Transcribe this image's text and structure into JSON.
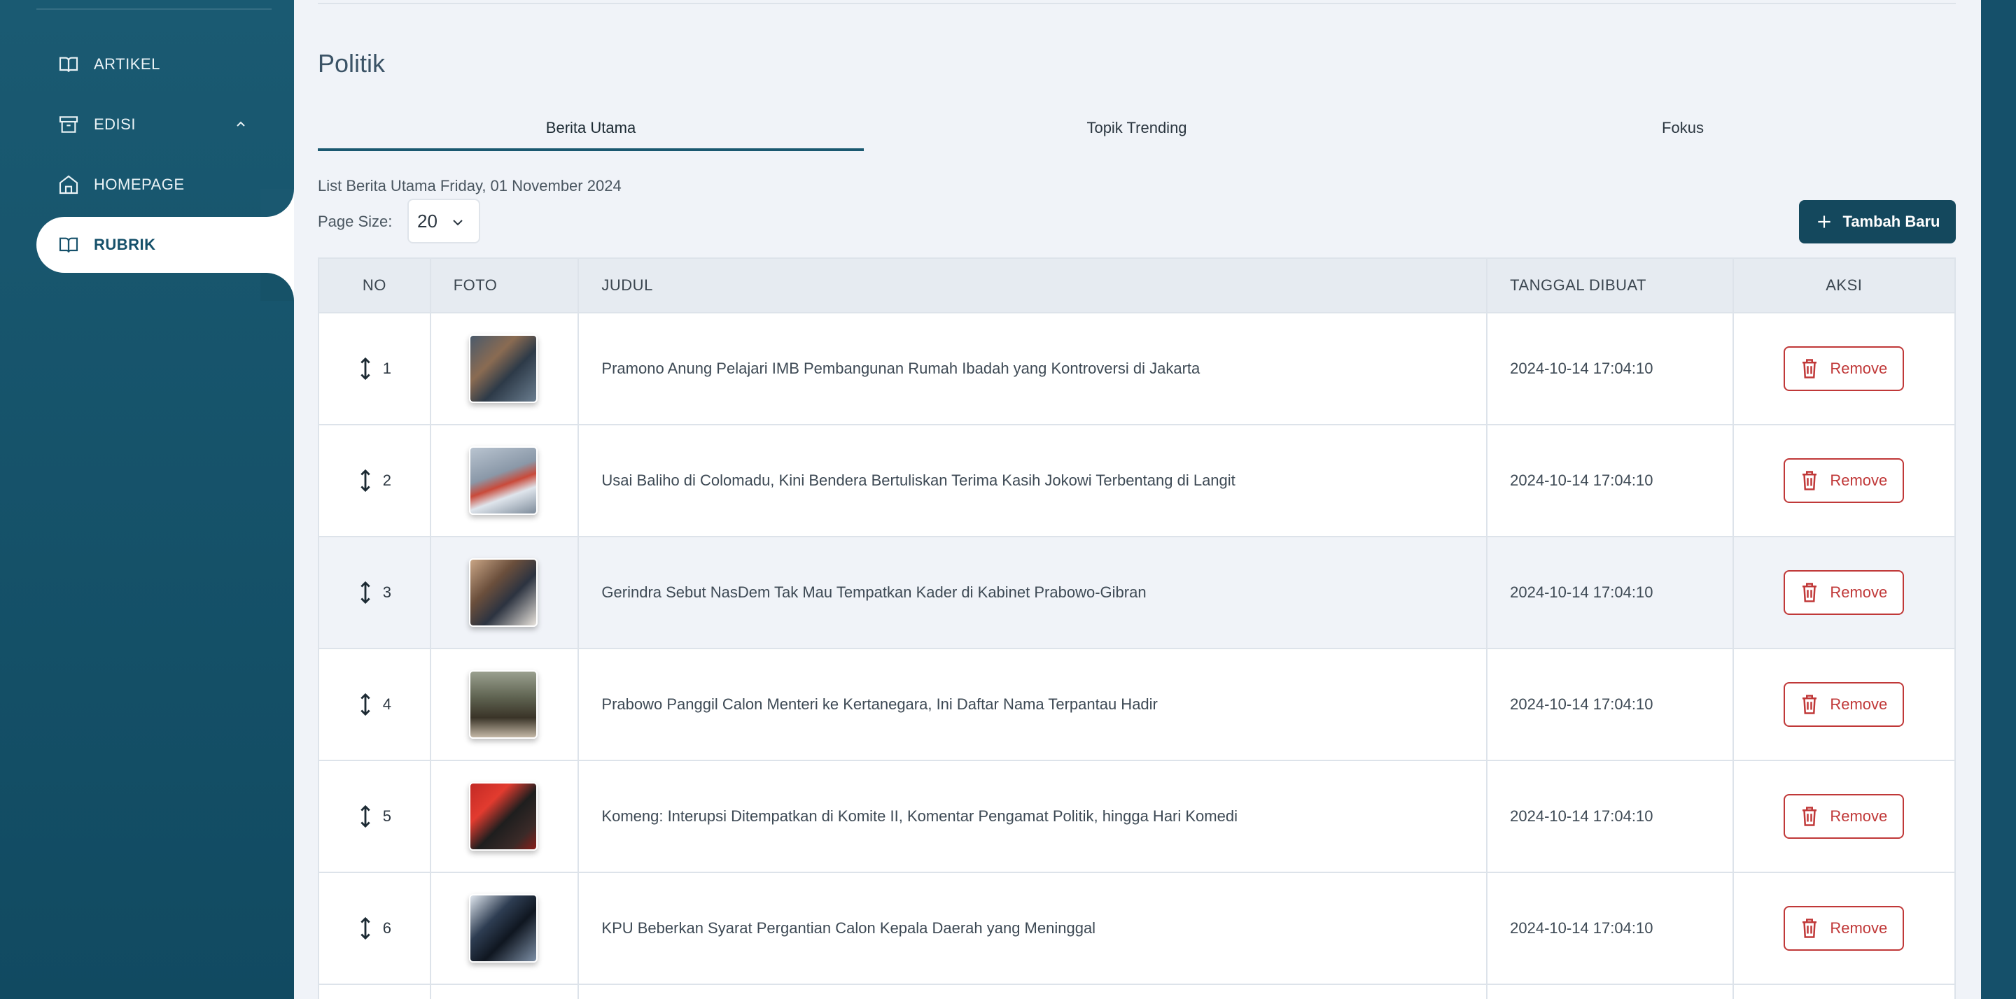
{
  "sidebar": {
    "items": [
      {
        "label": "ARTIKEL",
        "icon": "book-open-icon"
      },
      {
        "label": "EDISI",
        "icon": "archive-icon",
        "expanded": true
      },
      {
        "label": "HOMEPAGE",
        "icon": "home-icon"
      },
      {
        "label": "RUBRIK",
        "icon": "book-open-icon",
        "active": true
      }
    ]
  },
  "page": {
    "title": "Politik",
    "tabs": [
      {
        "label": "Berita Utama",
        "active": true
      },
      {
        "label": "Topik Trending",
        "active": false
      },
      {
        "label": "Fokus",
        "active": false
      }
    ],
    "list_caption": "List Berita Utama Friday, 01 November 2024",
    "page_size_label": "Page Size:",
    "page_size_value": "20",
    "add_button_label": "Tambah Baru"
  },
  "table": {
    "headers": {
      "no": "NO",
      "foto": "FOTO",
      "judul": "JUDUL",
      "tanggal": "TANGGAL DIBUAT",
      "aksi": "AKSI"
    },
    "remove_label": "Remove",
    "rows": [
      {
        "no": "1",
        "judul": "Pramono Anung Pelajari IMB Pembangunan Rumah Ibadah yang Kontroversi di Jakarta",
        "tanggal": "2024-10-14 17:04:10"
      },
      {
        "no": "2",
        "judul": "Usai Baliho di Colomadu, Kini Bendera Bertuliskan Terima Kasih Jokowi Terbentang di Langit",
        "tanggal": "2024-10-14 17:04:10"
      },
      {
        "no": "3",
        "judul": "Gerindra Sebut NasDem Tak Mau Tempatkan Kader di Kabinet Prabowo-Gibran",
        "tanggal": "2024-10-14 17:04:10"
      },
      {
        "no": "4",
        "judul": "Prabowo Panggil Calon Menteri ke Kertanegara, Ini Daftar Nama Terpantau Hadir",
        "tanggal": "2024-10-14 17:04:10"
      },
      {
        "no": "5",
        "judul": "Komeng: Interupsi Ditempatkan di Komite II, Komentar Pengamat Politik, hingga Hari Komedi",
        "tanggal": "2024-10-14 17:04:10"
      },
      {
        "no": "6",
        "judul": "KPU Beberkan Syarat Pergantian Calon Kepala Daerah yang Meninggal",
        "tanggal": "2024-10-14 17:04:10"
      }
    ]
  },
  "colors": {
    "primary": "#15506a",
    "danger": "#c03838",
    "background": "#f0f3f8"
  }
}
